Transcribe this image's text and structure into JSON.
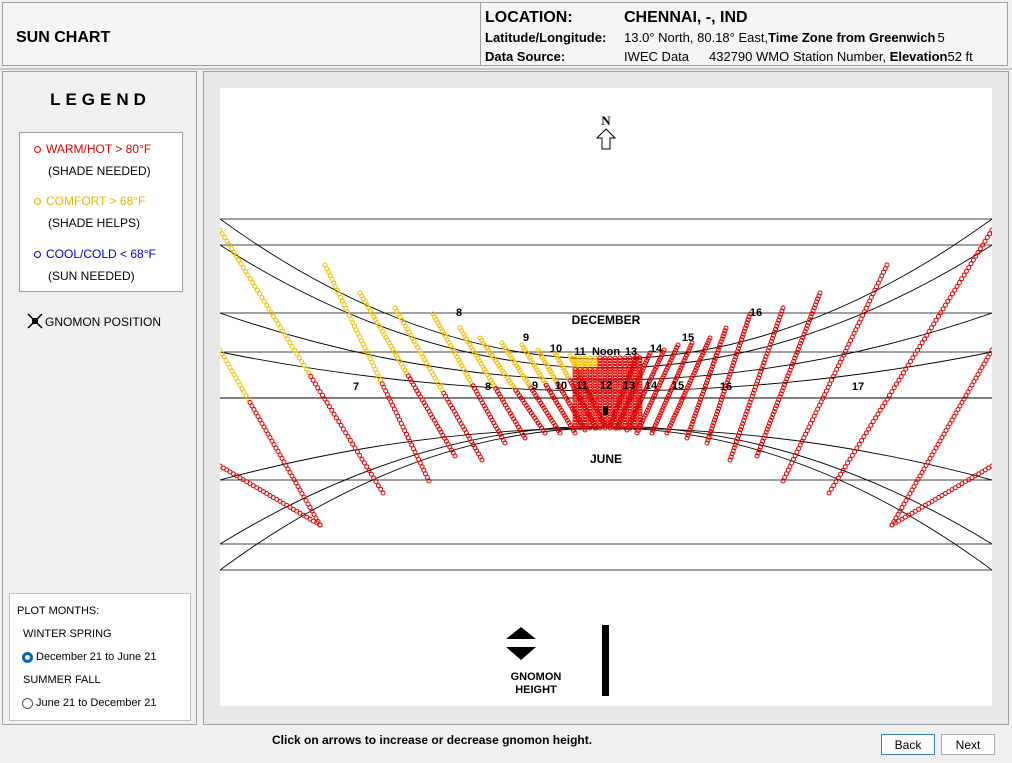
{
  "header": {
    "title": "SUN CHART",
    "location_label": "LOCATION:",
    "location_value": "CHENNAI, -, IND",
    "latlong_label": "Latitude/Longitude:",
    "latlong_value": "13.0° North, 80.18° East,",
    "timezone_label": "Time Zone from Greenwich",
    "timezone_value": "5",
    "source_label": "Data Source:",
    "source_value": "IWEC Data",
    "wmo_value": "432790 WMO Station Number,",
    "elevation_label": "Elevation",
    "elevation_value": "52 ft"
  },
  "legend": {
    "title": "LEGEND",
    "warm_label": "WARM/HOT  > 80°F",
    "warm_sub": "(SHADE NEEDED)",
    "comfort_label": "COMFORT  > 68°F",
    "comfort_sub": "(SHADE HELPS)",
    "cool_label": "COOL/COLD  < 68°F",
    "cool_sub": "(SUN NEEDED)",
    "gnomon_label": "GNOMON POSITION",
    "colors": {
      "warm": "#e00000",
      "comfort": "#f5c000",
      "cool": "#0000cc"
    }
  },
  "plot_months": {
    "title": "PLOT MONTHS:",
    "winter_spring": "WINTER SPRING",
    "option_1": "December 21 to June 21",
    "summer_fall": "SUMMER FALL",
    "option_2": "June 21 to December 21",
    "selected": "December 21 to June 21"
  },
  "chart": {
    "north": "N",
    "december": "DECEMBER",
    "june": "JUNE",
    "gnomon_height_1": "GNOMON",
    "gnomon_height_2": "HEIGHT",
    "dec_hours": [
      "8",
      "9",
      "10",
      "11",
      "Noon",
      "13",
      "14",
      "15",
      "16"
    ],
    "jun_hours": [
      "7",
      "8",
      "9",
      "10",
      "11",
      "12",
      "13",
      "14",
      "15",
      "16",
      "17"
    ]
  },
  "footer": {
    "instructions": "Click on arrows to increase or decrease gnomon height.",
    "back": "Back",
    "next": "Next"
  }
}
